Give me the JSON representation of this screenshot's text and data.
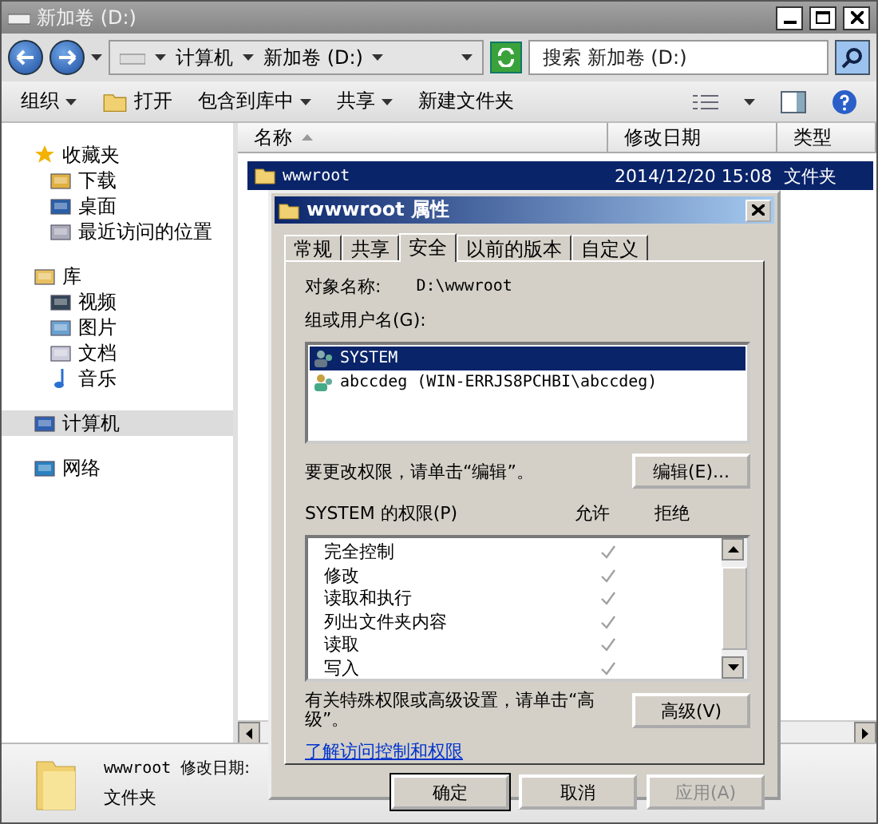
{
  "window": {
    "title": "新加卷 (D:)"
  },
  "address": {
    "crumbs": [
      "计算机",
      "新加卷 (D:)"
    ]
  },
  "search": {
    "placeholder": "搜索 新加卷 (D:)"
  },
  "toolbar": [
    {
      "label": "组织",
      "kind": "menu"
    },
    {
      "label": "打开",
      "kind": "open"
    },
    {
      "label": "包含到库中",
      "kind": "menu"
    },
    {
      "label": "共享",
      "kind": "menu"
    },
    {
      "label": "新建文件夹",
      "kind": "plain"
    }
  ],
  "sidebar": [
    {
      "label": "收藏夹",
      "kind": "star",
      "selected": false,
      "children": [
        {
          "label": "下载",
          "kind": "download",
          "selected": false
        },
        {
          "label": "桌面",
          "kind": "desktop",
          "selected": false
        },
        {
          "label": "最近访问的位置",
          "kind": "recent",
          "selected": false
        }
      ]
    },
    {
      "label": "库",
      "kind": "library",
      "selected": false,
      "children": [
        {
          "label": "视频",
          "kind": "video",
          "selected": false
        },
        {
          "label": "图片",
          "kind": "picture",
          "selected": false
        },
        {
          "label": "文档",
          "kind": "document",
          "selected": false
        },
        {
          "label": "音乐",
          "kind": "music",
          "selected": false
        }
      ]
    },
    {
      "label": "计算机",
      "kind": "computer",
      "selected": true
    },
    {
      "label": "网络",
      "kind": "network",
      "selected": false
    }
  ],
  "file_list": {
    "columns": [
      "名称",
      "修改日期",
      "类型"
    ],
    "rows": [
      {
        "name": "wwwroot",
        "modified": "2014/12/20 15:08",
        "type": "文件夹",
        "selected": true
      }
    ]
  },
  "details": {
    "name": "wwwroot",
    "modified_label": "修改日期:",
    "type": "文件夹"
  },
  "dialog": {
    "title": "wwwroot 属性",
    "tabs": [
      {
        "label": "常规",
        "selected": false
      },
      {
        "label": "共享",
        "selected": false
      },
      {
        "label": "安全",
        "selected": true
      },
      {
        "label": "以前的版本",
        "selected": false
      },
      {
        "label": "自定义",
        "selected": false
      }
    ],
    "object_label": "对象名称:",
    "object_value": "D:\\wwwroot",
    "groups_label": "组或用户名(G):",
    "principals": [
      {
        "name": "SYSTEM",
        "kind": "system",
        "selected": true
      },
      {
        "name": "abccdeg (WIN-ERRJS8PCHBI\\abccdeg)",
        "kind": "user",
        "selected": false
      }
    ],
    "edit_hint": "要更改权限，请单击“编辑”。",
    "edit_button": "编辑(E)...",
    "permissions_label": "SYSTEM 的权限(P)",
    "allow_header": "允许",
    "deny_header": "拒绝",
    "permissions": [
      {
        "name": "完全控制",
        "allow": true,
        "deny": false
      },
      {
        "name": "修改",
        "allow": true,
        "deny": false
      },
      {
        "name": "读取和执行",
        "allow": true,
        "deny": false
      },
      {
        "name": "列出文件夹内容",
        "allow": true,
        "deny": false
      },
      {
        "name": "读取",
        "allow": true,
        "deny": false
      },
      {
        "name": "写入",
        "allow": true,
        "deny": false
      }
    ],
    "advanced_hint": "有关特殊权限或高级设置，请单击“高级”。",
    "advanced_button": "高级(V)",
    "link": "了解访问控制和权限",
    "buttons": [
      {
        "label": "确定",
        "default": true,
        "disabled": false
      },
      {
        "label": "取消",
        "default": false,
        "disabled": false
      },
      {
        "label": "应用(A)",
        "default": false,
        "disabled": true
      }
    ]
  }
}
